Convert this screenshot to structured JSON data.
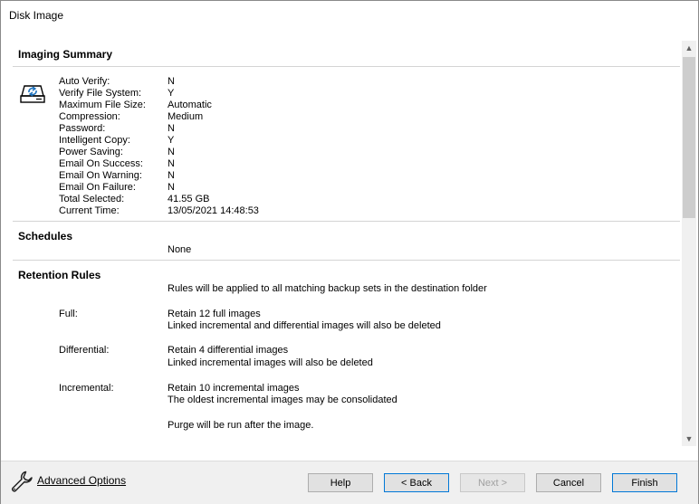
{
  "window": {
    "title": "Disk Image"
  },
  "imaging_summary": {
    "title": "Imaging Summary",
    "rows": [
      {
        "label": "Auto Verify:",
        "value": "N"
      },
      {
        "label": "Verify File System:",
        "value": "Y"
      },
      {
        "label": "Maximum File Size:",
        "value": "Automatic"
      },
      {
        "label": "Compression:",
        "value": "Medium"
      },
      {
        "label": "Password:",
        "value": "N"
      },
      {
        "label": "Intelligent Copy:",
        "value": "Y"
      },
      {
        "label": "Power Saving:",
        "value": "N"
      },
      {
        "label": "Email On Success:",
        "value": "N"
      },
      {
        "label": "Email On Warning:",
        "value": "N"
      },
      {
        "label": "Email On Failure:",
        "value": "N"
      },
      {
        "label": "Total Selected:",
        "value": "41.55 GB"
      },
      {
        "label": "Current Time:",
        "value": "13/05/2021 14:48:53"
      }
    ]
  },
  "schedules": {
    "title": "Schedules",
    "value": "None"
  },
  "retention": {
    "title": "Retention Rules",
    "intro": "Rules will be applied to all matching backup sets in the destination folder",
    "full": {
      "label": "Full:",
      "line1": "Retain 12 full images",
      "line2": "Linked incremental and differential images will also be deleted"
    },
    "differential": {
      "label": "Differential:",
      "line1": "Retain 4 differential images",
      "line2": "Linked incremental images will also be deleted"
    },
    "incremental": {
      "label": "Incremental:",
      "line1": "Retain 10 incremental images",
      "line2": "The oldest incremental images may be consolidated"
    },
    "purge": "Purge will be run after the image."
  },
  "footer": {
    "advanced_options": "Advanced Options",
    "help": "Help",
    "back": "< Back",
    "next": "Next >",
    "cancel": "Cancel",
    "finish": "Finish"
  },
  "icons": {
    "disk": "disk-image-icon",
    "wrench": "wrench-icon"
  }
}
